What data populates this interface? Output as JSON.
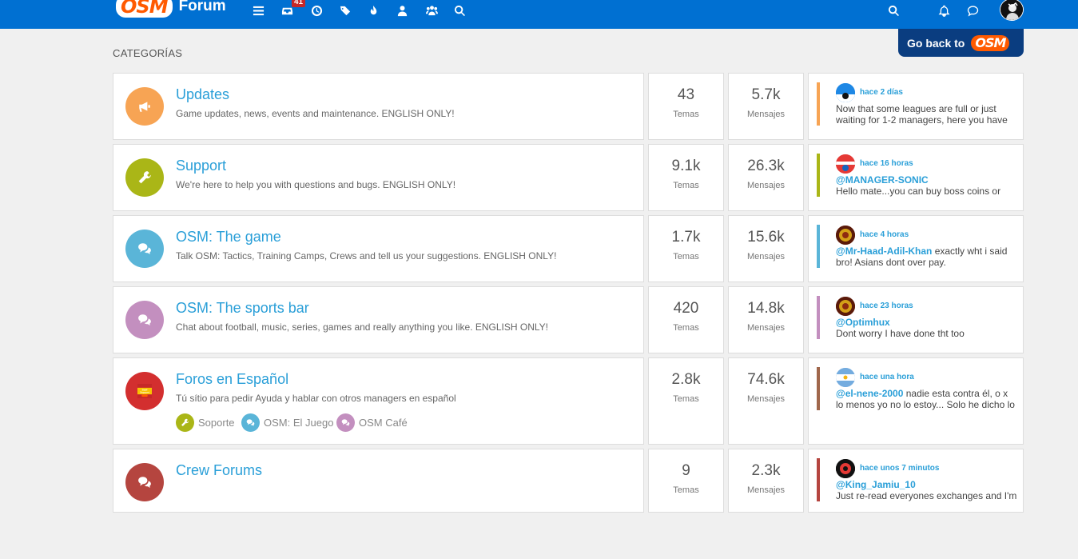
{
  "header": {
    "logo_text": "OSM",
    "brand": "Forum",
    "unread_count": "41",
    "nav_icons": [
      "list-icon",
      "inbox-icon",
      "clock-icon",
      "tags-icon",
      "fire-icon",
      "user-icon",
      "group-icon",
      "search-icon"
    ],
    "right_icons": [
      "search-icon",
      "bell-icon",
      "chat-icon",
      "avatar"
    ]
  },
  "go_back": {
    "label": "Go back to",
    "logo_text": "OSM"
  },
  "categories_heading": "CATEGORÍAS",
  "stat_labels": {
    "topics": "Temas",
    "posts": "Mensajes"
  },
  "categories": [
    {
      "title": "Updates",
      "description": "Game updates, news, events and maintenance. ENGLISH ONLY!",
      "icon": "megaphone-icon",
      "color": "#f7a454",
      "topics": "43",
      "posts": "5.7k",
      "last": {
        "time": "hace 2 días",
        "user": "",
        "line1": "Now that some leagues are full or just",
        "line2": "waiting for 1-2 managers, here you have",
        "avatar_color": "#1e88e5"
      }
    },
    {
      "title": "Support",
      "description": "We're here to help you with questions and bugs. ENGLISH ONLY!",
      "icon": "wrench-icon",
      "color": "#aab617",
      "topics": "9.1k",
      "posts": "26.3k",
      "last": {
        "time": "hace 16 horas",
        "user": "@MANAGER-SONIC",
        "line1": "",
        "line2": "Hello mate...you can buy boss coins or",
        "avatar_color": "#e53935"
      }
    },
    {
      "title": "OSM: The game",
      "description": "Talk OSM: Tactics, Training Camps, Crews and tell us your suggestions. ENGLISH ONLY!",
      "icon": "comments-icon",
      "color": "#5ab5d8",
      "topics": "1.7k",
      "posts": "15.6k",
      "last": {
        "time": "hace 4 horas",
        "user": "@Mr-Haad-Adil-Khan",
        "line1": " exactly wht i said",
        "line2": "bro! Asians dont over pay.",
        "avatar_color": "#8e2a10"
      }
    },
    {
      "title": "OSM: The sports bar",
      "description": "Chat about football, music, series, games and really anything you like. ENGLISH ONLY!",
      "icon": "comments-icon",
      "color": "#c38fbf",
      "topics": "420",
      "posts": "14.8k",
      "last": {
        "time": "hace 23 horas",
        "user": "@Optimhux",
        "line1": "",
        "line2": "Dont worry I have done tht too",
        "avatar_color": "#8e2a10"
      }
    },
    {
      "title": "Foros en Español",
      "description": "Tú sítio para pedir Ayuda y hablar con otros managers en español",
      "icon": "staff-support-image",
      "color": "#d32f2f",
      "topics": "2.8k",
      "posts": "74.6k",
      "subcategories": [
        {
          "label": "Soporte",
          "color": "#aab617",
          "icon": "wrench-icon"
        },
        {
          "label": "OSM: El Juego",
          "color": "#5ab5d8",
          "icon": "comments-icon"
        },
        {
          "label": "OSM Café",
          "color": "#c38fbf",
          "icon": "comments-icon"
        }
      ],
      "image_text": [
        "Staff",
        "Support"
      ],
      "last": {
        "time": "hace una hora",
        "user": "@el-nene-2000",
        "line1": " nadie esta contra él, o x",
        "line2": "lo menos yo no lo estoy... Solo he dicho lo",
        "avatar_color": "#74acdf"
      }
    },
    {
      "title": "Crew Forums",
      "description": "",
      "icon": "comments-icon",
      "color": "#b5453f",
      "topics": "9",
      "posts": "2.3k",
      "last": {
        "time": "hace unos 7 minutos",
        "user": "@King_Jamiu_10",
        "line1": "",
        "line2": "Just re-read everyones exchanges and I'm",
        "avatar_color": "#111111"
      }
    }
  ]
}
